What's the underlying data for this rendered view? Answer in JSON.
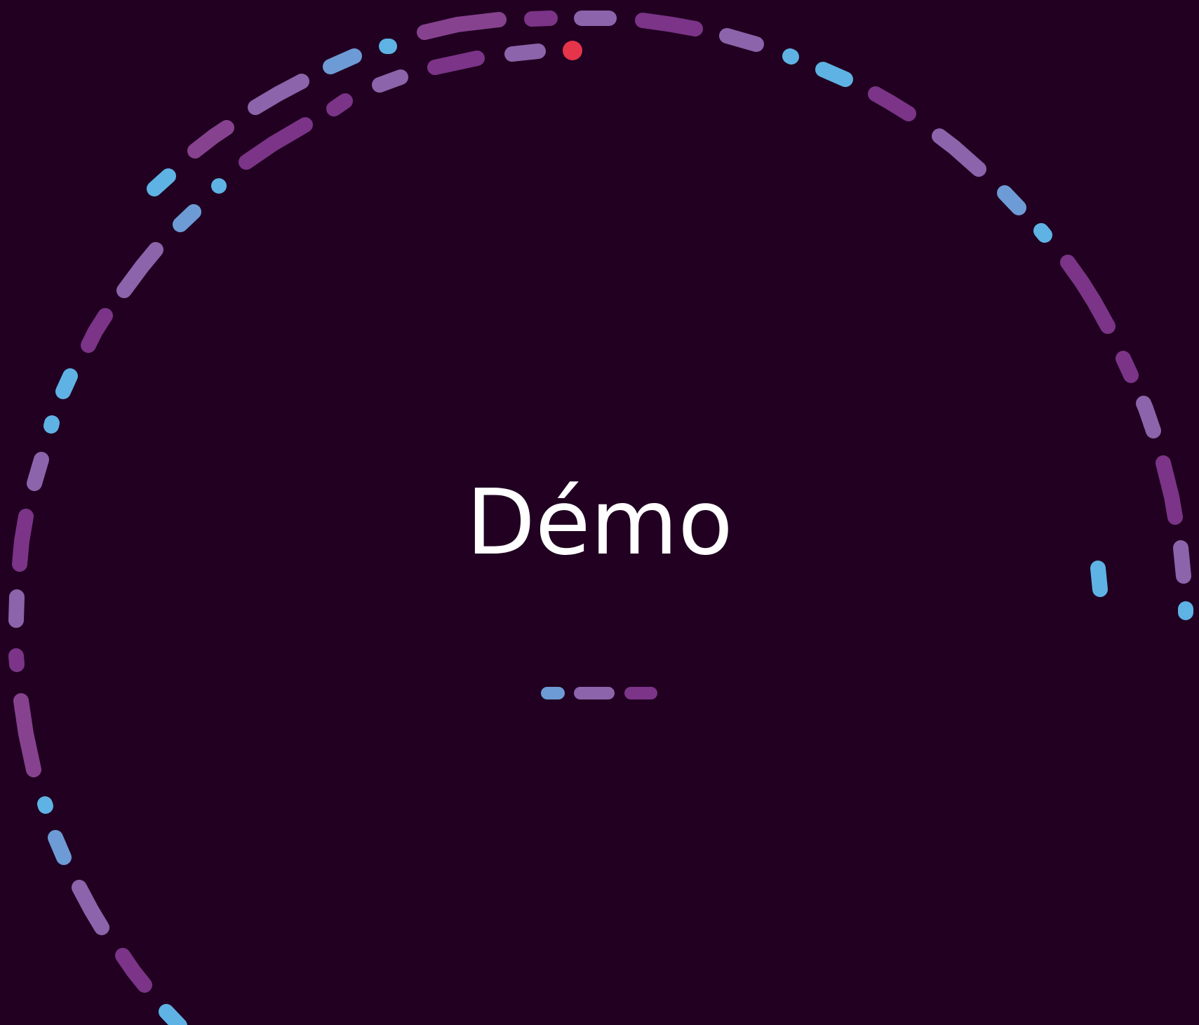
{
  "screen": {
    "title": "Démo",
    "colors": {
      "background": "#210021",
      "text": "#ffffff",
      "dash_palette": [
        "#5fb2e4",
        "#6d9bd5",
        "#8b64ab",
        "#7b3487",
        "#87428f"
      ],
      "indicator_dot": "#e6344b"
    },
    "loading_indicator": {
      "segments": [
        {
          "name": "indicator-segment-1",
          "color": "#6d9bd5"
        },
        {
          "name": "indicator-segment-2",
          "color": "#8b64ab"
        },
        {
          "name": "indicator-segment-3",
          "color": "#7b3487"
        }
      ]
    }
  }
}
